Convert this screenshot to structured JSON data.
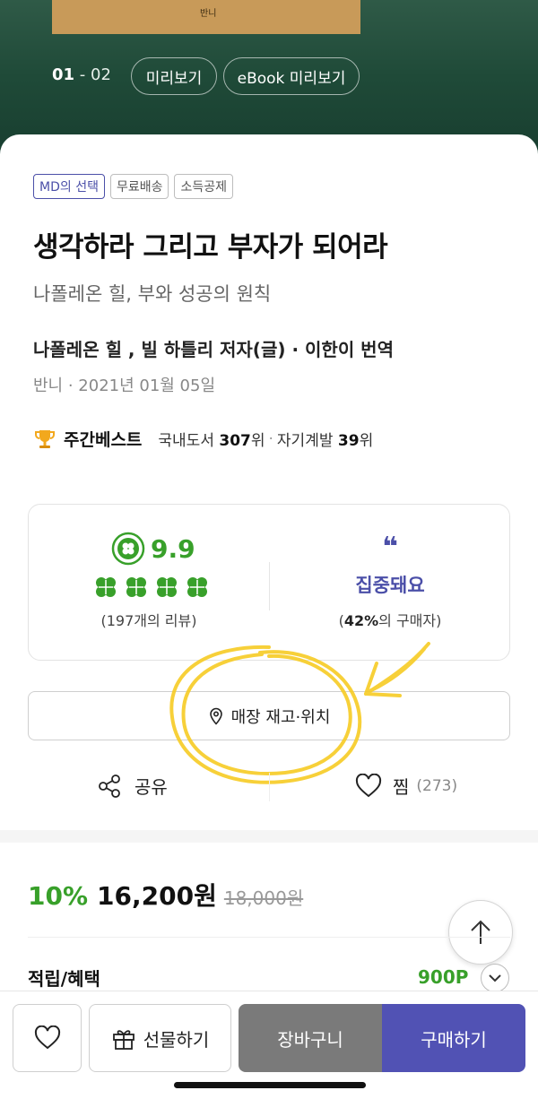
{
  "hero": {
    "cover_text": "반니",
    "page_current": "01",
    "page_rest": " - 02",
    "preview_label": "미리보기",
    "ebook_preview_label": "eBook 미리보기"
  },
  "badges": [
    "MD의 선택",
    "무료배송",
    "소득공제"
  ],
  "book": {
    "title": "생각하라 그리고 부자가 되어라",
    "subtitle": "나폴레온 힐, 부와 성공의 원칙",
    "author_line": "나폴레온 힐 , 빌 하틀리 저자(글) · 이한이 번역",
    "pub_line": "반니 · 2021년 01월 05일"
  },
  "ranking": {
    "label": "주간베스트",
    "cat1_name": "국내도서 ",
    "cat1_rank": "307",
    "cat1_suffix": "위",
    "sep": "·",
    "cat2_name": "자기계발 ",
    "cat2_rank": "39",
    "cat2_suffix": "위"
  },
  "review": {
    "score": "9.9",
    "clover_count": 4,
    "review_count_text": "(197개의 리뷰)",
    "quote_mark": "❝",
    "keyword": "집중돼요",
    "buyer_open": "(",
    "buyer_pct": "42%",
    "buyer_rest": "의 구매자)"
  },
  "store": {
    "label": "매장 재고·위치"
  },
  "actions": {
    "share_label": "공유",
    "wish_label": "찜",
    "wish_count": "(273)"
  },
  "price": {
    "discount": "10%",
    "sale": "16,200원",
    "original": "18,000원"
  },
  "reward": {
    "label": "적립/혜택",
    "value": "900P"
  },
  "bottom_bar": {
    "gift_label": "선물하기",
    "cart_label": "장바구니",
    "buy_label": "구매하기"
  },
  "colors": {
    "accent_green": "#38a02a",
    "accent_indigo": "#4b4fa8",
    "buy_button": "#5152b4",
    "cart_button": "#7a7a7a",
    "annotation_yellow": "#f7cc24"
  }
}
